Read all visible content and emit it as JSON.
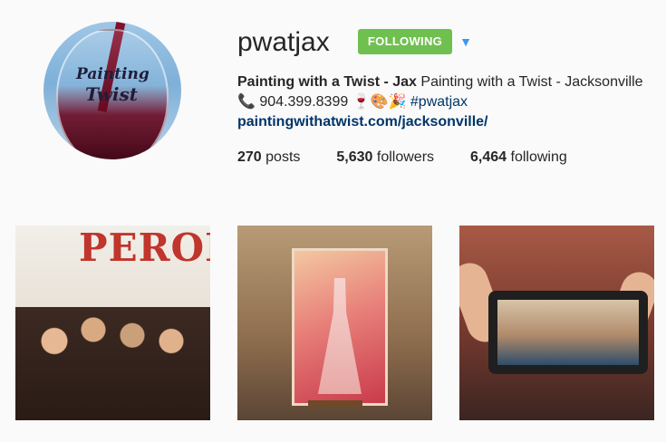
{
  "profile": {
    "username": "pwatjax",
    "follow_label": "FOLLOWING",
    "more_glyph": "▼",
    "bio": {
      "full_name": "Painting with a Twist - Jax",
      "description": " Painting with a Twist - Jacksonville",
      "phone": "📞 904.399.8399 🍷🎨🎉",
      "hashtag": "#pwatjax",
      "website": "paintingwithatwist.com/jacksonville/"
    },
    "avatar_text": {
      "line1": "Painting",
      "line2": "Twist"
    },
    "stats": [
      {
        "value": "270",
        "label": " posts"
      },
      {
        "value": "5,630",
        "label": " followers"
      },
      {
        "value": "6,464",
        "label": " following"
      }
    ]
  },
  "posts": {
    "tile1_sign": "PERON"
  },
  "colors": {
    "following_button": "#70c050",
    "link": "#003569",
    "accent": "#3897f0"
  },
  "icons": {
    "more": "chevron-down-icon"
  }
}
